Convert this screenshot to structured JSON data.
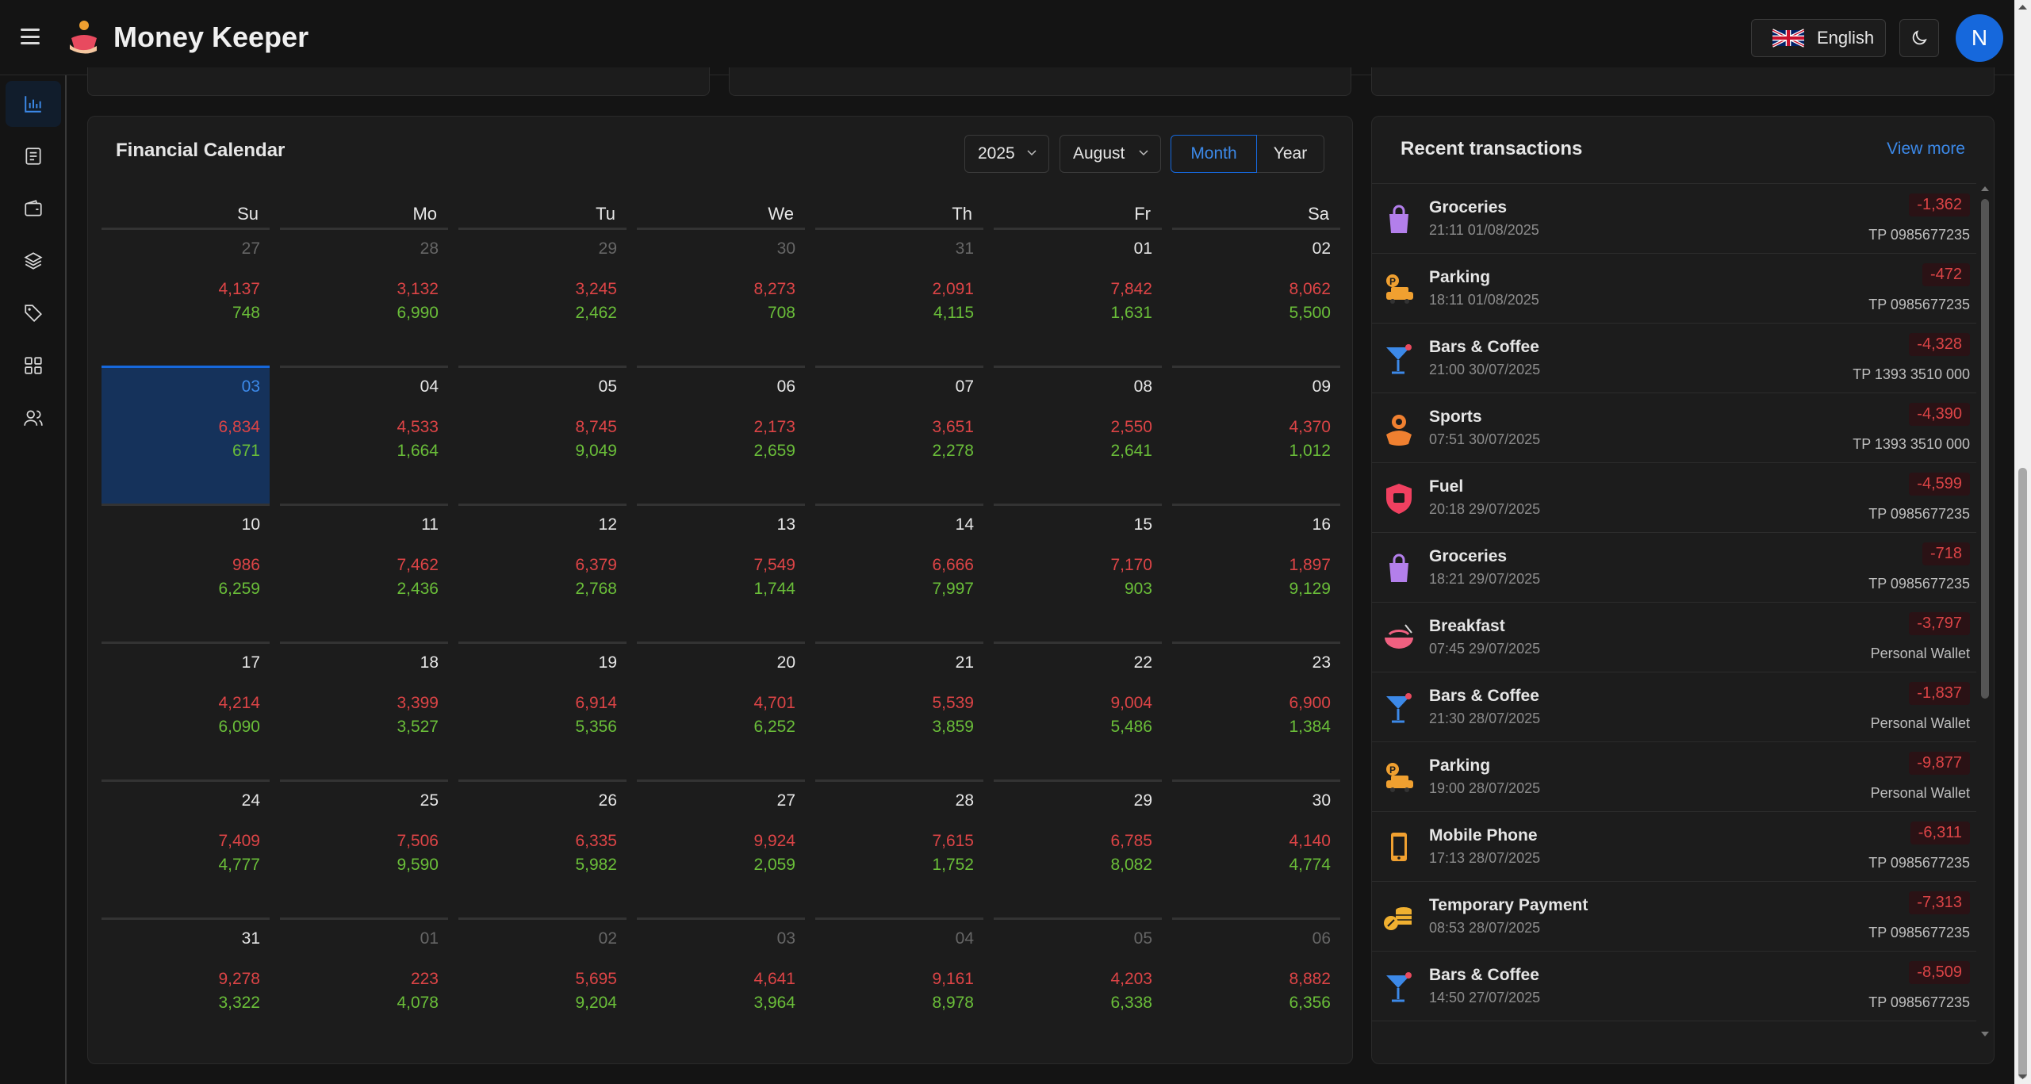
{
  "app": {
    "title": "Money Keeper"
  },
  "header": {
    "language": "English"
  },
  "user": {
    "avatar_initial": "N"
  },
  "sidebar": {
    "items": [
      "dashboard",
      "transactions",
      "wallets",
      "categories",
      "tags",
      "apps",
      "users"
    ]
  },
  "calendar": {
    "title": "Financial Calendar",
    "year": "2025",
    "month": "August",
    "view_month": "Month",
    "view_year": "Year",
    "weekdays": [
      "Su",
      "Mo",
      "Tu",
      "We",
      "Th",
      "Fr",
      "Sa"
    ],
    "selected_day": "03",
    "weeks": [
      [
        {
          "day": "27",
          "expense": "4,137",
          "income": "748",
          "other": true
        },
        {
          "day": "28",
          "expense": "3,132",
          "income": "6,990",
          "other": true
        },
        {
          "day": "29",
          "expense": "3,245",
          "income": "2,462",
          "other": true
        },
        {
          "day": "30",
          "expense": "8,273",
          "income": "708",
          "other": true
        },
        {
          "day": "31",
          "expense": "2,091",
          "income": "4,115",
          "other": true
        },
        {
          "day": "01",
          "expense": "7,842",
          "income": "1,631",
          "other": false
        },
        {
          "day": "02",
          "expense": "8,062",
          "income": "5,500",
          "other": false
        }
      ],
      [
        {
          "day": "03",
          "expense": "6,834",
          "income": "671",
          "other": false
        },
        {
          "day": "04",
          "expense": "4,533",
          "income": "1,664",
          "other": false
        },
        {
          "day": "05",
          "expense": "8,745",
          "income": "9,049",
          "other": false
        },
        {
          "day": "06",
          "expense": "2,173",
          "income": "2,659",
          "other": false
        },
        {
          "day": "07",
          "expense": "3,651",
          "income": "2,278",
          "other": false
        },
        {
          "day": "08",
          "expense": "2,550",
          "income": "2,641",
          "other": false
        },
        {
          "day": "09",
          "expense": "4,370",
          "income": "1,012",
          "other": false
        }
      ],
      [
        {
          "day": "10",
          "expense": "986",
          "income": "6,259",
          "other": false
        },
        {
          "day": "11",
          "expense": "7,462",
          "income": "2,436",
          "other": false
        },
        {
          "day": "12",
          "expense": "6,379",
          "income": "2,768",
          "other": false
        },
        {
          "day": "13",
          "expense": "7,549",
          "income": "1,744",
          "other": false
        },
        {
          "day": "14",
          "expense": "6,666",
          "income": "7,997",
          "other": false
        },
        {
          "day": "15",
          "expense": "7,170",
          "income": "903",
          "other": false
        },
        {
          "day": "16",
          "expense": "1,897",
          "income": "9,129",
          "other": false
        }
      ],
      [
        {
          "day": "17",
          "expense": "4,214",
          "income": "6,090",
          "other": false
        },
        {
          "day": "18",
          "expense": "3,399",
          "income": "3,527",
          "other": false
        },
        {
          "day": "19",
          "expense": "6,914",
          "income": "5,356",
          "other": false
        },
        {
          "day": "20",
          "expense": "4,701",
          "income": "6,252",
          "other": false
        },
        {
          "day": "21",
          "expense": "5,539",
          "income": "3,859",
          "other": false
        },
        {
          "day": "22",
          "expense": "9,004",
          "income": "5,486",
          "other": false
        },
        {
          "day": "23",
          "expense": "6,900",
          "income": "1,384",
          "other": false
        }
      ],
      [
        {
          "day": "24",
          "expense": "7,409",
          "income": "4,777",
          "other": false
        },
        {
          "day": "25",
          "expense": "7,506",
          "income": "9,590",
          "other": false
        },
        {
          "day": "26",
          "expense": "6,335",
          "income": "5,982",
          "other": false
        },
        {
          "day": "27",
          "expense": "9,924",
          "income": "2,059",
          "other": false
        },
        {
          "day": "28",
          "expense": "7,615",
          "income": "1,752",
          "other": false
        },
        {
          "day": "29",
          "expense": "6,785",
          "income": "8,082",
          "other": false
        },
        {
          "day": "30",
          "expense": "4,140",
          "income": "4,774",
          "other": false
        }
      ],
      [
        {
          "day": "31",
          "expense": "9,278",
          "income": "3,322",
          "other": false
        },
        {
          "day": "01",
          "expense": "223",
          "income": "4,078",
          "other": true
        },
        {
          "day": "02",
          "expense": "5,695",
          "income": "9,204",
          "other": true
        },
        {
          "day": "03",
          "expense": "4,641",
          "income": "3,964",
          "other": true
        },
        {
          "day": "04",
          "expense": "9,161",
          "income": "8,978",
          "other": true
        },
        {
          "day": "05",
          "expense": "4,203",
          "income": "6,338",
          "other": true
        },
        {
          "day": "06",
          "expense": "8,882",
          "income": "6,356",
          "other": true
        }
      ]
    ]
  },
  "transactions": {
    "title": "Recent transactions",
    "view_more": "View more",
    "items": [
      {
        "name": "Groceries",
        "time": "21:11 01/08/2025",
        "amount": "-1,362",
        "wallet": "TP 0985677235",
        "icon": "shopping-bag-icon",
        "color": "#b37feb"
      },
      {
        "name": "Parking",
        "time": "18:11 01/08/2025",
        "amount": "-472",
        "wallet": "TP 0985677235",
        "icon": "parking-car-icon",
        "color": "#f0a030"
      },
      {
        "name": "Bars & Coffee",
        "time": "21:00 30/07/2025",
        "amount": "-4,328",
        "wallet": "TP 1393 3510 000",
        "icon": "cocktail-icon",
        "color": "#3c89e8"
      },
      {
        "name": "Sports",
        "time": "07:51 30/07/2025",
        "amount": "-4,390",
        "wallet": "TP 1393 3510 000",
        "icon": "sports-icon",
        "color": "#f08030"
      },
      {
        "name": "Fuel",
        "time": "20:18 29/07/2025",
        "amount": "-4,599",
        "wallet": "TP 0985677235",
        "icon": "fuel-shield-icon",
        "color": "#f04060"
      },
      {
        "name": "Groceries",
        "time": "18:21 29/07/2025",
        "amount": "-718",
        "wallet": "TP 0985677235",
        "icon": "shopping-bag-icon",
        "color": "#b37feb"
      },
      {
        "name": "Breakfast",
        "time": "07:45 29/07/2025",
        "amount": "-3,797",
        "wallet": "Personal Wallet",
        "icon": "bowl-icon",
        "color": "#f06080"
      },
      {
        "name": "Bars & Coffee",
        "time": "21:30 28/07/2025",
        "amount": "-1,837",
        "wallet": "Personal Wallet",
        "icon": "cocktail-icon",
        "color": "#3c89e8"
      },
      {
        "name": "Parking",
        "time": "19:00 28/07/2025",
        "amount": "-9,877",
        "wallet": "Personal Wallet",
        "icon": "parking-car-icon",
        "color": "#f0a030"
      },
      {
        "name": "Mobile Phone",
        "time": "17:13 28/07/2025",
        "amount": "-6,311",
        "wallet": "TP 0985677235",
        "icon": "mobile-phone-icon",
        "color": "#f0a030"
      },
      {
        "name": "Temporary Payment",
        "time": "08:53 28/07/2025",
        "amount": "-7,313",
        "wallet": "TP 0985677235",
        "icon": "coins-icon",
        "color": "#f0b030"
      },
      {
        "name": "Bars & Coffee",
        "time": "14:50 27/07/2025",
        "amount": "-8,509",
        "wallet": "TP 0985677235",
        "icon": "cocktail-icon",
        "color": "#3c89e8"
      }
    ]
  }
}
